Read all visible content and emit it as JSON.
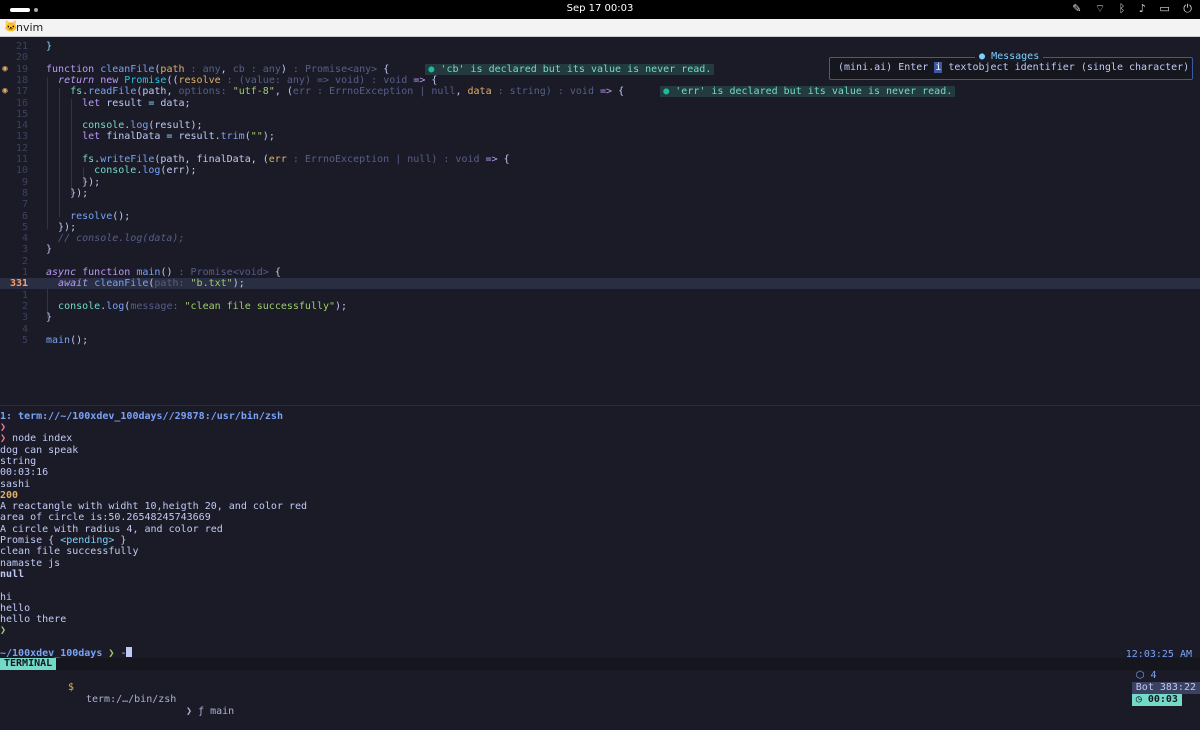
{
  "topbar": {
    "clock": "Sep 17  00:03",
    "icons": [
      "pen-icon",
      "wifi-icon",
      "bluetooth-icon",
      "volume-icon",
      "battery-icon",
      "power-icon"
    ]
  },
  "window": {
    "title": "nvim"
  },
  "editor": {
    "lines": [
      {
        "num": "21",
        "html": "<span class=\"o\">}</span>"
      },
      {
        "num": "20",
        "html": ""
      },
      {
        "num": "19",
        "icon": "lightbulb-icon",
        "html": "<span class=\"k\">function</span> <span class=\"f\">cleanFile</span>(<span class=\"p\">path</span><span class=\"h\"> : any</span>, <span class=\"h\">cb : any</span>)<span class=\"h\"> : Promise&lt;any&gt;</span> {      <span class=\"diag\"><span class=\"b\">●</span> 'cb' is declared but its value is never read.</span>"
      },
      {
        "num": "18",
        "html": "  <span class=\"ki\">return</span> <span class=\"k\">new</span> <span class=\"t\">Promise</span>((<span class=\"p\">resolve</span><span class=\"h\"> : (value: any) =&gt; void)</span><span class=\"h\"> : void</span> <span class=\"k\">=&gt;</span> {"
      },
      {
        "num": "17",
        "icon": "lightbulb-icon",
        "html": "    <span class=\"pr\">fs</span>.<span class=\"f\">readFile</span>(path, <span class=\"h\">options: </span><span class=\"s\">\"utf-8\"</span>, (<span class=\"h\">err : ErrnoException | null</span>, <span class=\"p\">data</span><span class=\"h\"> : string)</span><span class=\"h\"> : void</span> <span class=\"k\">=&gt;</span> {      <span class=\"diag\"><span class=\"b\">●</span> 'err' is declared but its value is never read.</span>"
      },
      {
        "num": "16",
        "html": "      <span class=\"k\">let</span> result <span class=\"o\">=</span> data;"
      },
      {
        "num": "15",
        "html": ""
      },
      {
        "num": "14",
        "html": "      <span class=\"pr\">console</span>.<span class=\"f\">log</span>(result);"
      },
      {
        "num": "13",
        "html": "      <span class=\"k\">let</span> finalData <span class=\"o\">=</span> result.<span class=\"f\">trim</span>(<span class=\"s\">\"\"</span>);"
      },
      {
        "num": "12",
        "html": ""
      },
      {
        "num": "11",
        "html": "      <span class=\"pr\">fs</span>.<span class=\"f\">writeFile</span>(path, finalData, (<span class=\"p\">err</span><span class=\"h\"> : ErrnoException | null)</span><span class=\"h\"> : void</span> <span class=\"k\">=&gt;</span> {"
      },
      {
        "num": "10",
        "html": "        <span class=\"pr\">console</span>.<span class=\"f\">log</span>(err);"
      },
      {
        "num": "9",
        "html": "      });"
      },
      {
        "num": "8",
        "html": "    });"
      },
      {
        "num": "7",
        "html": ""
      },
      {
        "num": "6",
        "html": "    <span class=\"f\">resolve</span>();"
      },
      {
        "num": "5",
        "html": "  });"
      },
      {
        "num": "4",
        "html": "  <span class=\"c\">// console.log(data);</span>"
      },
      {
        "num": "3",
        "html": "}"
      },
      {
        "num": "2",
        "html": ""
      },
      {
        "num": "1",
        "html": "<span class=\"ki\">async</span> <span class=\"k\">function</span> <span class=\"f\">main</span>()<span class=\"h\"> : Promise&lt;void&gt;</span> {"
      },
      {
        "num": "331",
        "current": true,
        "html": "  <span class=\"ki\">await</span> <span class=\"f\">cleanFile</span>(<span class=\"h\">path: </span><span class=\"s\">\"b.txt\"</span>);"
      },
      {
        "num": "1",
        "html": ""
      },
      {
        "num": "2",
        "html": "  <span class=\"pr\">console</span>.<span class=\"f\">log</span>(<span class=\"h\">message: </span><span class=\"s\">\"clean file successfully\"</span>);"
      },
      {
        "num": "3",
        "html": "}"
      },
      {
        "num": "4",
        "html": ""
      },
      {
        "num": "5",
        "html": "<span class=\"f\">main</span>();"
      }
    ]
  },
  "messages": {
    "title": "Messages",
    "text_before": "(mini.ai) Enter ",
    "highlight": "i",
    "text_after": " textobject identifier (single character)"
  },
  "terminal": {
    "title": "1: term://~/100xdev_100days//29878:/usr/bin/zsh",
    "lines": [
      {
        "html": "<span class=\"red\">❯</span>"
      },
      {
        "html": "<span class=\"red\">❯</span> node index"
      },
      {
        "html": "dog can speak"
      },
      {
        "html": "string"
      },
      {
        "html": "00:03:16"
      },
      {
        "html": "sashi"
      },
      {
        "html": "<span class=\"yel\">200</span>"
      },
      {
        "html": "A reactangle with widht 10,heigth 20, and color red"
      },
      {
        "html": "area of circle is:50.26548245743669"
      },
      {
        "html": "A circle with radius 4, and color red"
      },
      {
        "html": "Promise { <span class=\"cyan\">&lt;pending&gt;</span> }"
      },
      {
        "html": "clean file successfully"
      },
      {
        "html": "namaste js"
      },
      {
        "html": "<span class=\"bold\">null</span>"
      },
      {
        "html": ""
      },
      {
        "html": "hi"
      },
      {
        "html": "hello"
      },
      {
        "html": "hello there"
      },
      {
        "html": "<span class=\"grn\">❯</span>"
      }
    ],
    "prompt_path": "~/100xdev_100days",
    "prompt_sym": "❯",
    "prompt_input": "-",
    "time": "12:03:25 AM"
  },
  "status": {
    "mode": "TERMINAL",
    "dollar": "$",
    "path": "term:/…/bin/zsh",
    "sep": "❯",
    "func": "ƒ main",
    "lsp": "⬡ 4",
    "pos": "Bot 383:22",
    "time": "◷ 00:03"
  }
}
